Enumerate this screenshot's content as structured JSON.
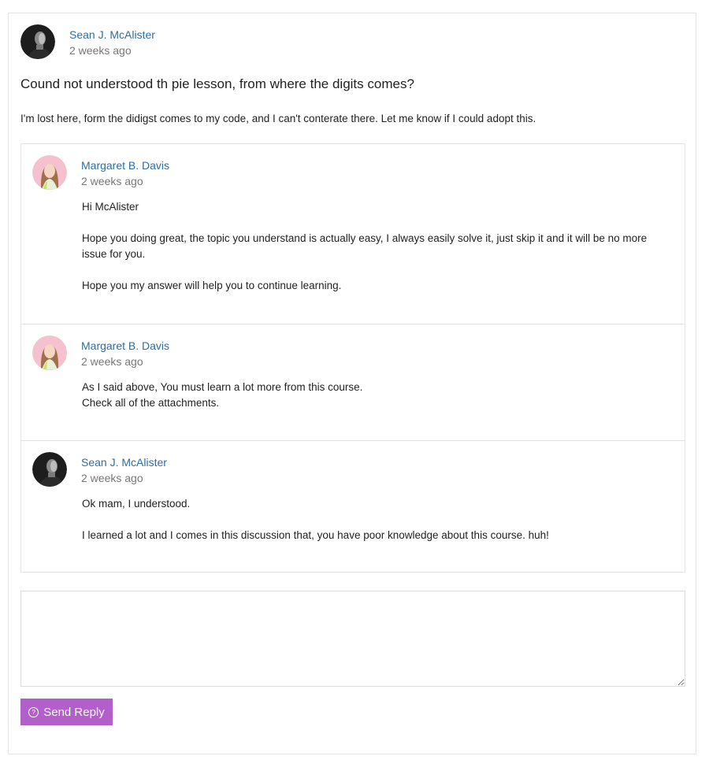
{
  "post": {
    "author": "Sean J. McAlister",
    "time": "2 weeks ago",
    "title": "Cound not understood th pie lesson, from where the digits comes?",
    "body": "I'm lost here, form the didigst comes to my code, and I can't conterate there. Let me know if I could adopt this."
  },
  "replies": [
    {
      "author": "Margaret B. Davis",
      "time": "2 weeks ago",
      "paragraphs": [
        "Hi McAlister",
        "Hope you doing great, the topic you understand is actually easy, I always easily solve it, just skip it and it will be no more issue for you.",
        "Hope you my answer will help you to continue learning."
      ]
    },
    {
      "author": "Margaret B. Davis",
      "time": "2 weeks ago",
      "paragraphs": [
        "As I said above, You must learn a lot more from this course.",
        "Check all of the attachments."
      ]
    },
    {
      "author": "Sean J. McAlister",
      "time": "2 weeks ago",
      "paragraphs": [
        "Ok mam, I understood.",
        "I learned a lot and I comes in this discussion that, you have poor knowledge about this course. huh!"
      ]
    }
  ],
  "reply_form": {
    "value": "",
    "send_label": "Send Reply",
    "send_icon": "question-circle-icon",
    "button_color": "#b25fcc"
  },
  "colors": {
    "link": "#2e6da4",
    "muted": "#777777"
  }
}
